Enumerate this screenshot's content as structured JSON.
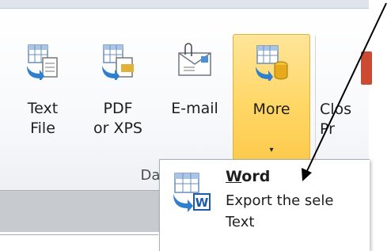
{
  "ribbon": {
    "buttons": [
      {
        "label": "Text\nFile",
        "icon": "table-export-text-icon"
      },
      {
        "label": "PDF\nor XPS",
        "icon": "table-export-pdf-icon"
      },
      {
        "label": "E-mail",
        "icon": "email-envelope-icon"
      },
      {
        "label": "More",
        "icon": "table-export-more-icon",
        "dropdown": "▾"
      }
    ],
    "group_label": "Data",
    "next_button_label": "Clos\nPr"
  },
  "menu": {
    "item": {
      "title": "Word",
      "title_access_key": "W",
      "title_rest": "ord",
      "description": "Export the sele\nText",
      "icon": "word-export-icon"
    }
  },
  "colors": {
    "more_button_fill": "#ffd766",
    "more_button_border": "#e3b13a",
    "ribbon_bg": "#ffffff",
    "status_bar_bg": "#c7cbd0",
    "arrow_color": "#000000",
    "word_icon_blue": "#1f5aa8"
  }
}
